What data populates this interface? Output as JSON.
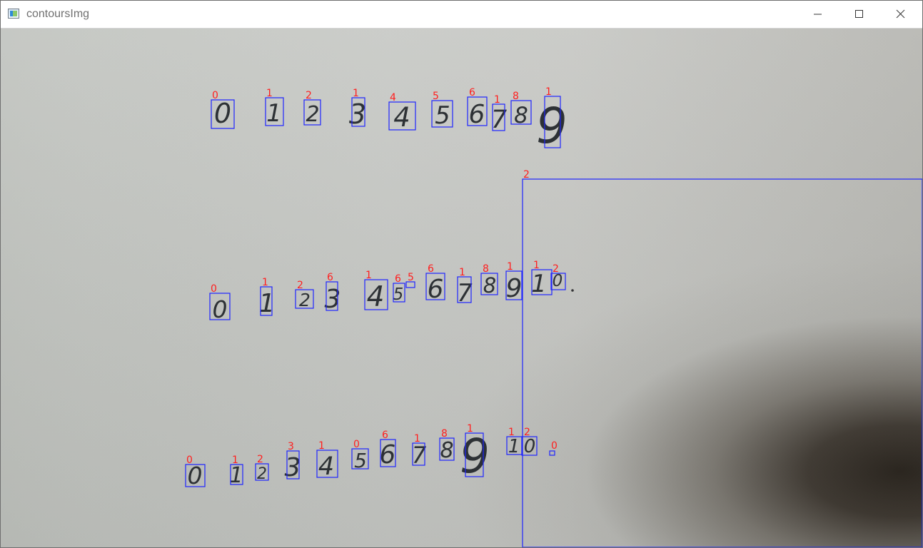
{
  "window": {
    "title": "contoursImg",
    "app_icon": "opencv-window-icon",
    "controls": {
      "minimize_icon": "minimize-icon",
      "maximize_icon": "maximize-icon",
      "close_icon": "close-icon"
    }
  },
  "colors": {
    "box": "#1e24ff",
    "label": "#ff1f1f",
    "ink": "#2d3135",
    "title_text": "#707070"
  },
  "detections": [
    {
      "row": 1,
      "label": "0",
      "digit": "0"
    },
    {
      "row": 1,
      "label": "1",
      "digit": "1"
    },
    {
      "row": 1,
      "label": "2",
      "digit": "2"
    },
    {
      "row": 1,
      "label": "1",
      "digit": "3"
    },
    {
      "row": 1,
      "label": "4",
      "digit": "4"
    },
    {
      "row": 1,
      "label": "5",
      "digit": "5"
    },
    {
      "row": 1,
      "label": "6",
      "digit": "6"
    },
    {
      "row": 1,
      "label": "1",
      "digit": "7"
    },
    {
      "row": 1,
      "label": "8",
      "digit": "8"
    },
    {
      "row": 1,
      "label": "1",
      "digit": "9"
    },
    {
      "row": 2,
      "label": "2",
      "digit": ""
    },
    {
      "row": 3,
      "label": "0",
      "digit": "0"
    },
    {
      "row": 3,
      "label": "1",
      "digit": "1"
    },
    {
      "row": 3,
      "label": "2",
      "digit": "2"
    },
    {
      "row": 3,
      "label": "6",
      "digit": "3"
    },
    {
      "row": 3,
      "label": "1",
      "digit": "4"
    },
    {
      "row": 3,
      "label": "6",
      "digit": "5"
    },
    {
      "row": 3,
      "label": "5",
      "digit": ""
    },
    {
      "row": 3,
      "label": "6",
      "digit": "6"
    },
    {
      "row": 3,
      "label": "1",
      "digit": "7"
    },
    {
      "row": 3,
      "label": "8",
      "digit": "8"
    },
    {
      "row": 3,
      "label": "1",
      "digit": "9"
    },
    {
      "row": 3,
      "label": "1",
      "digit": "1"
    },
    {
      "row": 3,
      "label": "2",
      "digit": "0"
    },
    {
      "row": 4,
      "label": "0",
      "digit": "0"
    },
    {
      "row": 4,
      "label": "1",
      "digit": "1"
    },
    {
      "row": 4,
      "label": "2",
      "digit": "2"
    },
    {
      "row": 4,
      "label": "3",
      "digit": "3"
    },
    {
      "row": 4,
      "label": "1",
      "digit": "4"
    },
    {
      "row": 4,
      "label": "0",
      "digit": "5"
    },
    {
      "row": 4,
      "label": "6",
      "digit": "6"
    },
    {
      "row": 4,
      "label": "1",
      "digit": "7"
    },
    {
      "row": 4,
      "label": "8",
      "digit": "8"
    },
    {
      "row": 4,
      "label": "1",
      "digit": "9"
    },
    {
      "row": 4,
      "label": "1",
      "digit": "1"
    },
    {
      "row": 4,
      "label": "2",
      "digit": "0"
    },
    {
      "row": 4,
      "label": "0",
      "digit": ""
    }
  ]
}
